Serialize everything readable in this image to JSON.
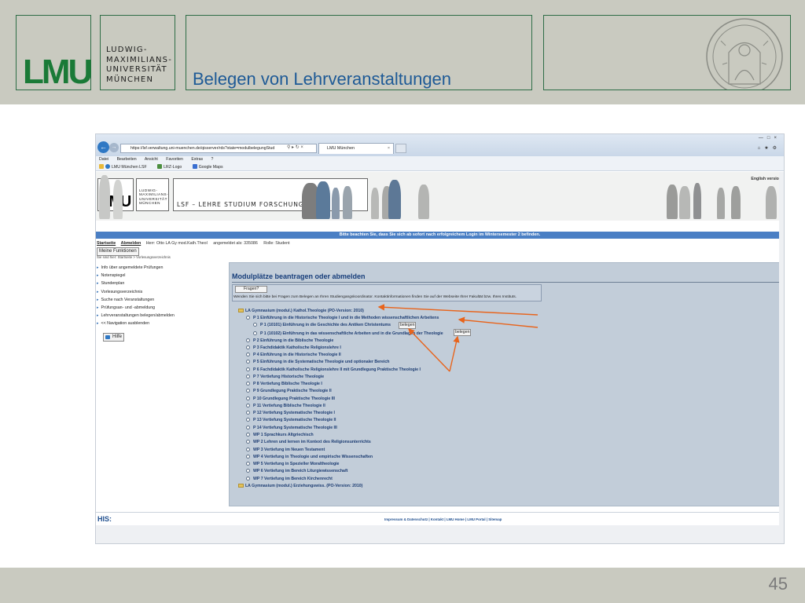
{
  "slide": {
    "title": "Belegen von Lehrveranstaltungen",
    "page_number": "45",
    "logo_text": "LMU",
    "university_name": [
      "LUDWIG-",
      "MAXIMILIANS-",
      "UNIVERSITÄT",
      "MÜNCHEN"
    ]
  },
  "browser": {
    "url": "https://lsf.verwaltung.uni-muenchen.de/qisserver/rds?state=modulbelegungStud",
    "tab_title": "LMU München",
    "menu": [
      "Datei",
      "Bearbeiten",
      "Ansicht",
      "Favoriten",
      "Extras",
      "?"
    ],
    "favorites": [
      "LMU München LSF",
      "LRZ-Logo",
      "Google Maps"
    ]
  },
  "site": {
    "logo_text": "LMU",
    "name_lines": [
      "LUDWIG-",
      "MAXIMILIANS-",
      "UNIVERSITÄT",
      "MÜNCHEN"
    ],
    "lsf_title": "LSF – LEHRE STUDIUM FORSCHUNG",
    "english_link": "English version",
    "info_strip": "Bitte beachten Sie, dass Sie sich ab sofort nach erfolgreichem Login im Wintersemester 2        befinden.",
    "userbar": {
      "startseite": "Startseite",
      "abmelden": "Abmelden",
      "user": "Herr: Otto LA Gy mod.Kath.Theol",
      "login": "angemeldet als: 335086",
      "role": "Rolle: Student"
    },
    "breadcrumb": "Sie sind hier: Startseite > Vorlesungsverzeichnis",
    "meine_funktionen": "Meine Funktionen",
    "left_nav": [
      "Info über angemeldete Prüfungen",
      "Notenspiegel",
      "Stundenplan",
      "Vorlesungsverzeichnis",
      "Suche nach Veranstaltungen",
      "Prüfungsan- und -abmeldung",
      "Lehrveranstaltungen belegen/abmelden",
      "<< Navigation ausblenden"
    ],
    "hilfe": "Hilfe",
    "footer_logo": "HIS:",
    "footer_links": "Impressum & Datenschutz | Kontakt | LMU Home | LMU Portal | Sitemap"
  },
  "main": {
    "title": "Modulplätze beantragen oder abmelden",
    "fragen_button": "Fragen?",
    "fragen_text": "Wenden Sie sich bitte bei Fragen zum Belegen an Ihren Studiengangskoordinator. Kontaktinformationen finden Sie auf der Webseite Ihrer Fakultät bzw. Ihres Instituts.",
    "belegen_label": "belegen",
    "tree": [
      "LA Gymnasium (modul.) Kathol.Theologie (PO-Version: 2010)",
      "P 1 Einführung in die Historische Theologie I und in die Methoden wissenschaftlichen Arbeitens",
      "P 1 (10101) Einführung in die Geschichte des Antiken Christentums",
      "P 1 (10102) Einführung in das wissenschaftliche Arbeiten und in die Grundlagen der Theologie",
      "P 2 Einführung in die Biblische Theologie",
      "P 3 Fachdidaktik Katholische Religionslehre I",
      "P 4 Einführung in die Historische Theologie II",
      "P 5 Einführung in die Systematische Theologie und optionaler Bereich",
      "P 6 Fachdidaktik Katholische Religionslehre II mit Grundlegung Praktische Theologie I",
      "P 7 Vertiefung Historische Theologie",
      "P 8 Vertiefung Biblische Theologie I",
      "P 9 Grundlegung Praktische Theologie II",
      "P 10 Grundlegung Praktische Theologie III",
      "P 11 Vertiefung Biblische Theologie II",
      "P 12 Vertiefung Systematische Theologie I",
      "P 13 Vertiefung Systematische Theologie II",
      "P 14 Vertiefung Systematische Theologie III",
      "WP 1 Sprachkurs Altgriechisch",
      "WP 2 Lehren und lernen im Kontext des Religionsunterrichts",
      "WP 3 Vertiefung im Neuen Testament",
      "WP 4 Vertiefung in Theologie und empirische Wissenschaften",
      "WP 5 Vertiefung in Spezieller Moraltheologie",
      "WP 6 Vertiefung im Bereich Liturgiewissenschaft",
      "WP 7 Vertiefung im Bereich Kirchenrecht",
      "LA Gymnasium (modul.) Erziehungswiss. (PO-Version: 2010)"
    ]
  },
  "colors": {
    "header_bg": "#c9cac0",
    "lmu_green": "#1a7a37",
    "title_blue": "#1e5a96",
    "panel_bg": "#c2cdd9",
    "arrow_orange": "#e8641c"
  }
}
